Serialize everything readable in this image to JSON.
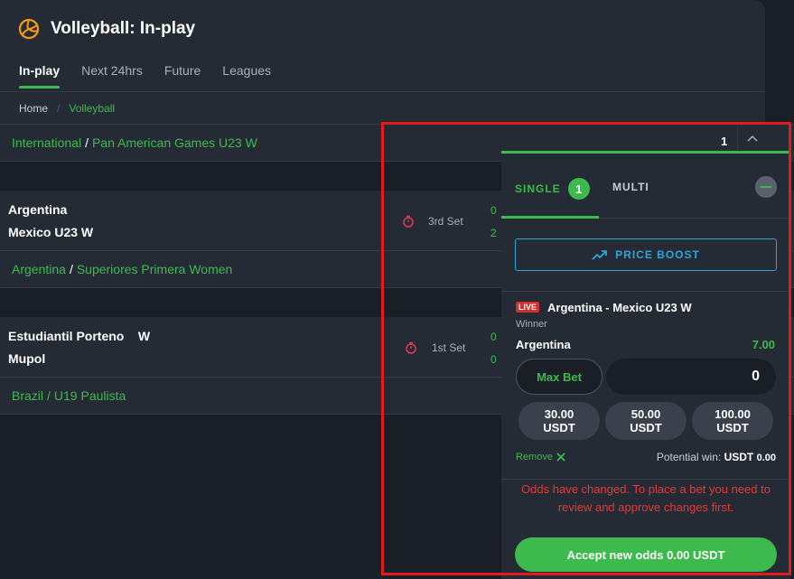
{
  "header": {
    "title": "Volleyball: In-play",
    "tabs": [
      {
        "label": "In-play",
        "active": true
      },
      {
        "label": "Next 24hrs",
        "active": false
      },
      {
        "label": "Future",
        "active": false
      },
      {
        "label": "Leagues",
        "active": false
      }
    ],
    "breadcrumb": {
      "home": "Home",
      "current": "Volleyball"
    }
  },
  "leagues": [
    {
      "country": "International",
      "name": "Pan American Games U23 W",
      "matches": [
        {
          "home": "Argentina",
          "away": "Mexico U23 W",
          "status": "3rd Set",
          "home_score": "0",
          "away_score": "2"
        }
      ]
    },
    {
      "country": "Argentina",
      "name": "Superiores Primera Women",
      "matches": [
        {
          "home": "Estudiantil Porteno    W",
          "away": "Mupol",
          "status": "1st Set",
          "home_score": "0",
          "away_score": "0"
        }
      ]
    },
    {
      "country": "Brazil",
      "name": "U19 Paulista",
      "matches": []
    }
  ],
  "betslip": {
    "count": "1",
    "tabs": {
      "single_label": "SINGLE",
      "single_count": "1",
      "multi_label": "MULTI"
    },
    "price_boost_label": "PRICE BOOST",
    "bet": {
      "live_label": "LIVE",
      "event": "Argentina - Mexico U23 W",
      "market": "Winner",
      "selection": "Argentina",
      "odds": "7.00",
      "max_bet_label": "Max Bet",
      "stake_value": "0",
      "quick_stakes": [
        {
          "amount": "30.00",
          "currency": "USDT"
        },
        {
          "amount": "50.00",
          "currency": "USDT"
        },
        {
          "amount": "100.00",
          "currency": "USDT"
        }
      ],
      "remove_label": "Remove",
      "potential_win_label": "Potential win:",
      "potential_win_currency": "USDT",
      "potential_win_value": "0.00"
    },
    "odds_changed_message": "Odds have changed. To place a bet you need to review and approve changes first.",
    "accept_label": "Accept new odds",
    "accept_amount": "0.00 USDT"
  },
  "colors": {
    "accent": "#3dba4e",
    "boost": "#2aa6d8",
    "error": "#e53935",
    "live": "#d32f2f",
    "highlight": "#e21c1c"
  }
}
